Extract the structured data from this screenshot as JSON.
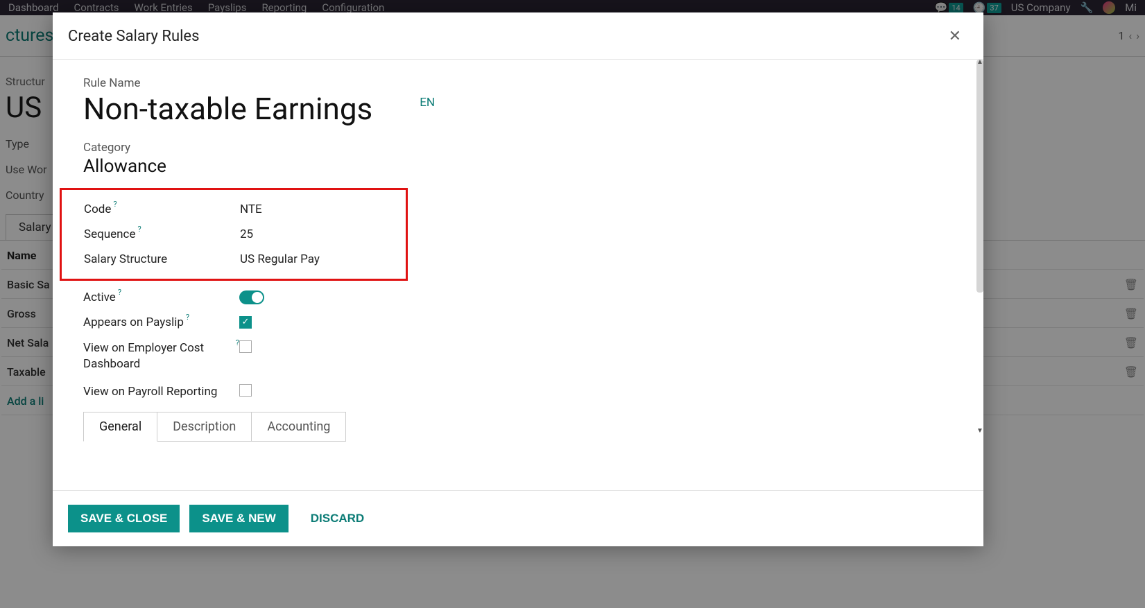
{
  "topbar": {
    "nav": [
      "Dashboard",
      "Contracts",
      "Work Entries",
      "Payslips",
      "Reporting",
      "Configuration"
    ],
    "badge1": "14",
    "badge2": "37",
    "company": "US Company",
    "user": "Mi"
  },
  "background": {
    "breadcrumb_partial": "ctures",
    "pager_value": "1",
    "struct_label": "Structur",
    "struct_name": "US",
    "field1": "Type",
    "field2": "Use Wor",
    "field3": "Country",
    "tab": "Salary",
    "table": {
      "header": "Name",
      "rows": [
        "Basic Sa",
        "Gross",
        "Net Sala",
        "Taxable"
      ],
      "add": "Add a li"
    }
  },
  "modal": {
    "title": "Create Salary Rules",
    "rule_label": "Rule Name",
    "rule_name": "Non-taxable Earnings",
    "lang": "EN",
    "cat_label": "Category",
    "cat_value": "Allowance",
    "fields": {
      "code_lbl": "Code",
      "code_val": "NTE",
      "seq_lbl": "Sequence",
      "seq_val": "25",
      "struct_lbl": "Salary Structure",
      "struct_val": "US Regular Pay",
      "active_lbl": "Active",
      "payslip_lbl": "Appears on Payslip",
      "cost_lbl": "View on Employer Cost Dashboard",
      "report_lbl": "View on Payroll Reporting"
    },
    "help": "?",
    "tabs": [
      "General",
      "Description",
      "Accounting"
    ],
    "buttons": {
      "save_close": "SAVE & CLOSE",
      "save_new": "SAVE & NEW",
      "discard": "DISCARD"
    }
  }
}
